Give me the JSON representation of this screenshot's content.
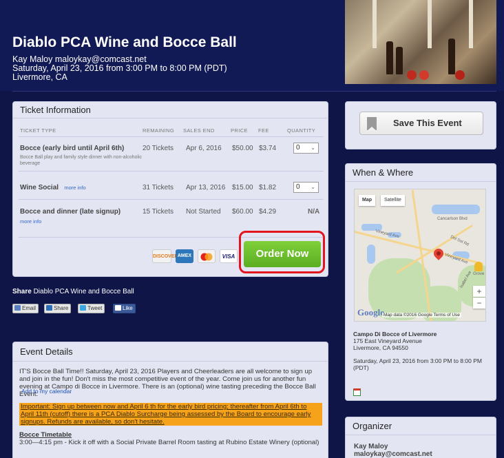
{
  "event": {
    "title": "Diablo PCA Wine and Bocce Ball",
    "organizer_line": "Kay Maloy maloykay@comcast.net",
    "date_line": "Saturday, April 23, 2016 from 3:00 PM to 8:00 PM (PDT)",
    "location_line": "Livermore, CA"
  },
  "tickets": {
    "panel_title": "Ticket Information",
    "headers": [
      "TICKET TYPE",
      "REMAINING",
      "SALES END",
      "PRICE",
      "FEE",
      "QUANTITY"
    ],
    "rows": [
      {
        "name": "Bocce (early bird until April 6th)",
        "desc": "Bocce Ball play and family style dinner with non-alcoholic beverage",
        "more": "",
        "remaining": "20 Tickets",
        "sales_end": "Apr 6, 2016",
        "price": "$50.00",
        "fee": "$3.74",
        "qty": "0"
      },
      {
        "name": "Wine Social",
        "desc": "",
        "more": "more info",
        "remaining": "31 Tickets",
        "sales_end": "Apr 13, 2016",
        "price": "$15.00",
        "fee": "$1.82",
        "qty": "0"
      },
      {
        "name": "Bocce and dinner (late signup)",
        "desc": "",
        "more": "more info",
        "remaining": "15 Tickets",
        "sales_end": "Not Started",
        "price": "$60.00",
        "fee": "$4.29",
        "qty": "N/A"
      }
    ],
    "cards": [
      "DISCOVER",
      "AMEX",
      "MC",
      "VISA"
    ],
    "order_button": "Order Now"
  },
  "share": {
    "label": "Share",
    "event_name": "Diablo PCA Wine and Bocce Ball",
    "buttons": [
      "Email",
      "Share",
      "Tweet",
      "Like"
    ]
  },
  "details": {
    "panel_title": "Event Details",
    "intro": "IT'S Bocce Ball Time!!  Saturday, April 23, 2016 Players and Cheerleaders are all welcome to sign up and join in the fun! Don't miss the most competitive event of the year. Come join us for another fun evening at Campo di Bocce in Livermore. There is an (optional) wine tasting preceding the Bocce Ball Event.",
    "important": "Important:  Sign up between now and April 6 th for the early bird pricing; thereafter from April 6th to April 11th (cutoff) there is a PCA Diablo Surcharge being assessed by the Board to encourage early signups. Refunds are available, so don't hesitate.",
    "timetable_title": "Bocce Timetable",
    "timetable_line": "3:00—4:15 pm - Kick it off with a Social Private Barrel Room tasting at Rubino Estate Winery (optional)"
  },
  "save": {
    "label": "Save This Event"
  },
  "when_where": {
    "panel_title": "When & Where",
    "map_tabs": [
      "Map",
      "Satellite"
    ],
    "map_labels": [
      "Cancarlson Blvd",
      "Vineyard Ave",
      "Vineyard Ave",
      "Del Sol Rd",
      "Isabel Ave",
      "Grove"
    ],
    "map_footer": "Map data ©2016 Google   Terms of Use",
    "google": "Google",
    "venue": "Campo Di Bocce of Livermore",
    "address1": "175 East Vineyard Avenue",
    "address2": "Livermore, CA 94550",
    "datetime": "Saturday, April 23, 2016 from 3:00 PM to 8:00 PM (PDT)",
    "calendar": "Add to my calendar"
  },
  "organizer": {
    "panel_title": "Organizer",
    "name": "Kay Maloy",
    "email": "maloykay@comcast.net"
  },
  "colors": {
    "background": "#0f1647",
    "order_green": "#6cbf2c",
    "highlight": "#f7a21b",
    "focus_ring": "#e3141e"
  }
}
